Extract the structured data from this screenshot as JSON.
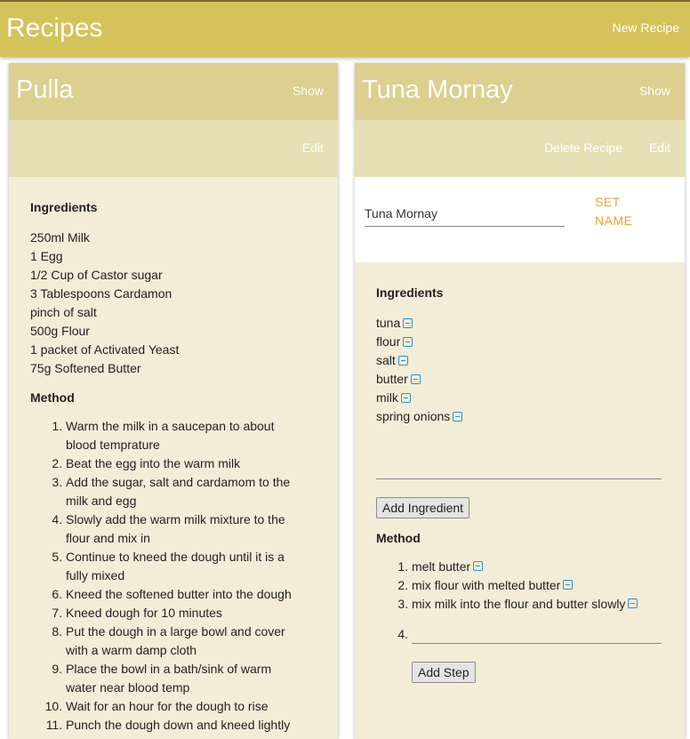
{
  "app": {
    "title": "Recipes",
    "new_recipe_label": "New Recipe"
  },
  "recipes": [
    {
      "name": "Pulla",
      "show_label": "Show",
      "edit_label": "Edit",
      "ingredients_title": "Ingredients",
      "ingredients": [
        "250ml Milk",
        "1 Egg",
        "1/2 Cup of Castor sugar",
        "3 Tablespoons Cardamon",
        "pinch of salt",
        "500g Flour",
        "1 packet of Activated Yeast",
        "75g Softened Butter"
      ],
      "method_title": "Method",
      "steps": [
        "Warm the milk in a saucepan to about blood temprature",
        "Beat the egg into the warm milk",
        "Add the sugar, salt and cardamom to the milk and egg",
        "Slowly add the warm milk mixture to the flour and mix in",
        "Continue to kneed the dough until it is a fully mixed",
        "Kneed the softened butter into the dough",
        "Kneed dough for 10 minutes",
        "Put the dough in a large bowl and cover with a warm damp cloth",
        "Place the bowl in a bath/sink of warm water near blood temp",
        "Wait for an hour for the dough to rise",
        "Punch the dough down and kneed lightly"
      ]
    },
    {
      "name": "Tuna Mornay",
      "show_label": "Show",
      "delete_label": "Delete Recipe",
      "edit_label": "Edit",
      "name_input_value": "Tuna Mornay",
      "set_name_label": "SET NAME",
      "ingredients_title": "Ingredients",
      "ingredients": [
        "tuna",
        "flour",
        "salt",
        "butter",
        "milk",
        "spring onions"
      ],
      "ingredient_input_value": "",
      "add_ingredient_label": "Add Ingredient",
      "method_title": "Method",
      "steps": [
        "melt butter",
        "mix flour with melted butter",
        "mix milk into the flour and butter slowly"
      ],
      "new_step_number": "4.",
      "step_input_value": "",
      "add_step_label": "Add Step"
    }
  ],
  "icons": {
    "remove": "minus-square-icon"
  },
  "colors": {
    "appbar": "#d4c25b",
    "card_header": "#dccf8f",
    "card_actions": "#e7dfb5",
    "card_body": "#f2edd7",
    "accent_orange": "#f0a030",
    "remove_icon": "#2f8fd6"
  }
}
